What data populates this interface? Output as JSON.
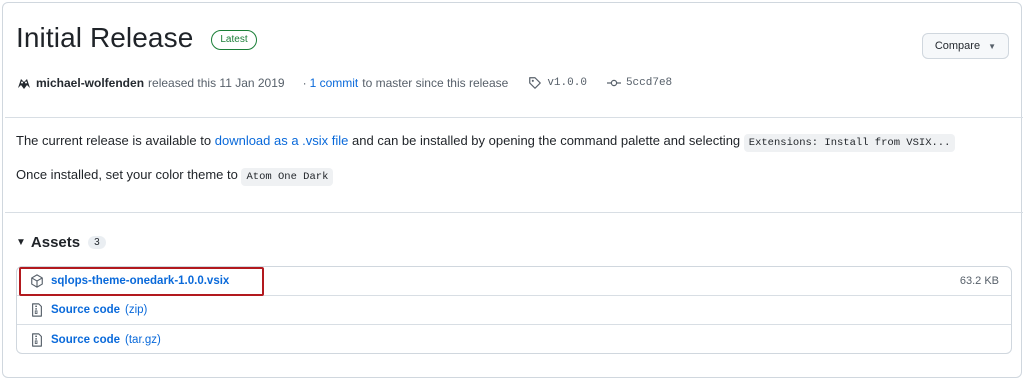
{
  "release": {
    "title": "Initial Release",
    "badge": "Latest",
    "compare_label": "Compare",
    "author": "michael-wolfenden",
    "released_text": "released this 11 Jan 2019",
    "commit_link": "1 commit",
    "commit_suffix": "to master since this release",
    "tag": "v1.0.0",
    "commit_hash": "5ccd7e8"
  },
  "description": {
    "line1_prefix": "The current release is available to",
    "line1_link": "download as a .vsix file",
    "line1_middle": "and can be installed by opening the command palette and selecting",
    "line1_code": "Extensions: Install from VSIX...",
    "line2_prefix": "Once installed, set your color theme to",
    "line2_code": "Atom One Dark"
  },
  "assets": {
    "heading": "Assets",
    "count": "3",
    "items": [
      {
        "name": "sqlops-theme-onedark-1.0.0.vsix",
        "ext": "",
        "size": "63.2 KB",
        "icon": "package-icon"
      },
      {
        "name": "Source code",
        "ext": "(zip)",
        "size": "",
        "icon": "file-zip-icon"
      },
      {
        "name": "Source code",
        "ext": "(tar.gz)",
        "size": "",
        "icon": "file-zip-icon"
      }
    ]
  },
  "colors": {
    "link": "#0969da",
    "badge_green": "#1a7f37",
    "highlight": "#b2191e"
  }
}
